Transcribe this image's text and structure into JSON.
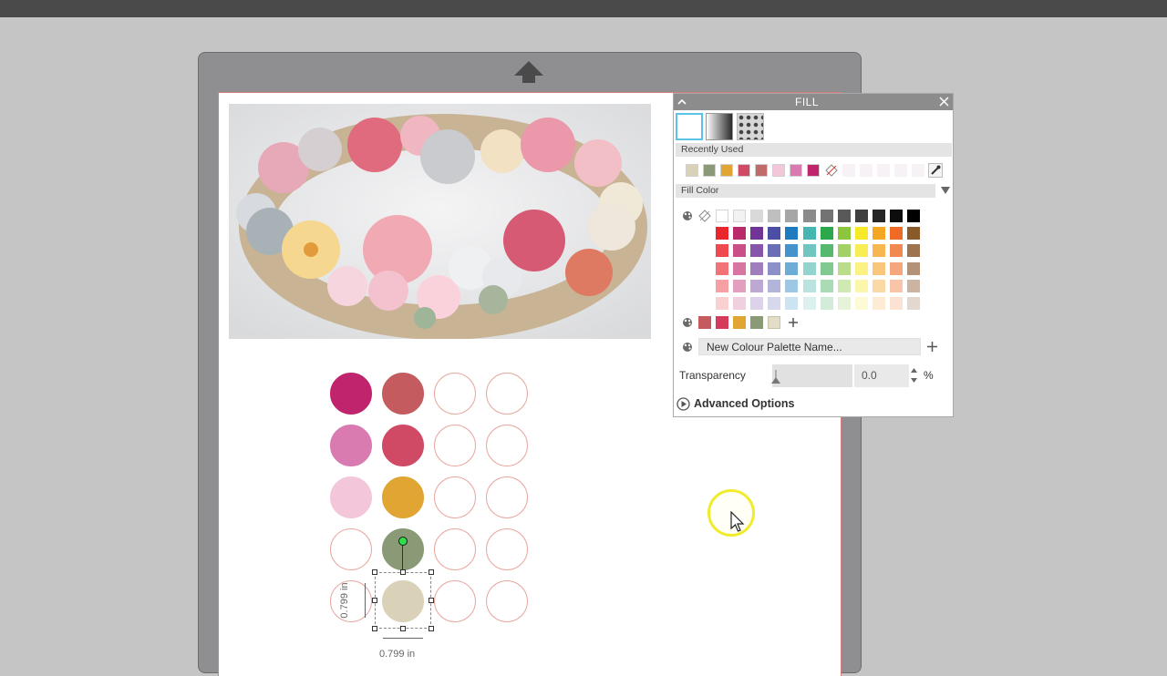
{
  "fill_panel": {
    "title": "FILL",
    "recently_used_label": "Recently Used",
    "fill_color_label": "Fill Color",
    "palette_name_placeholder": "New Colour Palette Name...",
    "transparency_label": "Transparency",
    "transparency_value": "0.0",
    "transparency_unit": "%",
    "advanced_label": "Advanced Options",
    "recently_used": [
      "#d9d1b8",
      "#8a9a76",
      "#e0a532",
      "#d04a66",
      "#c06a6a",
      "#f4c6d9",
      "#d97ab0",
      "#c0246c"
    ],
    "custom_palette": [
      "#c35b5f",
      "#d53b5b",
      "#e0a532",
      "#8a9a76",
      "#e3dcc6"
    ],
    "grid": [
      [
        "#ffffff",
        "#f2f2f2",
        "#d9d9d9",
        "#bfbfbf",
        "#a6a6a6",
        "#8c8c8c",
        "#737373",
        "#595959",
        "#404040",
        "#262626",
        "#0d0d0d",
        "#000000"
      ],
      [
        "#e8262b",
        "#b82a6b",
        "#6f3496",
        "#4a4ea5",
        "#1f7bbe",
        "#46b7b0",
        "#2aa84a",
        "#8cc63f",
        "#f7e928",
        "#f5a623",
        "#ef6b25",
        "#8b5a2b"
      ],
      [
        "#ee4a4f",
        "#c94f86",
        "#8756aa",
        "#6a6eb7",
        "#4493cc",
        "#6fc5bf",
        "#57b96d",
        "#a3d165",
        "#f9ed56",
        "#f7b64f",
        "#f28950",
        "#9e7450"
      ],
      [
        "#f27377",
        "#d676a1",
        "#a07ebe",
        "#8c8fc8",
        "#6eacd8",
        "#94d4cf",
        "#80ca91",
        "#badc8b",
        "#fbf283",
        "#f9c77b",
        "#f5a67c",
        "#b39277"
      ],
      [
        "#f6a0a3",
        "#e3a0be",
        "#bda7d3",
        "#b2b4da",
        "#9cc8e6",
        "#b9e3df",
        "#a9dbb5",
        "#d0e8b1",
        "#fcf6ad",
        "#fbd9a7",
        "#f9c5a8",
        "#cbb4a1"
      ],
      [
        "#fad0d1",
        "#f0cfde",
        "#dcd2e9",
        "#d7d8ec",
        "#cce3f2",
        "#dcf1ef",
        "#d3ecd9",
        "#e7f3d8",
        "#fdfad6",
        "#fdecd3",
        "#fce2d3",
        "#e3d8cf"
      ]
    ]
  },
  "canvas": {
    "circles": [
      [
        "#c0246c",
        "#c35b5f",
        "",
        ""
      ],
      [
        "#d97ab0",
        "#d04a66",
        "",
        ""
      ],
      [
        "#f4c6d9",
        "#e0a532",
        "",
        ""
      ],
      [
        "",
        "#8a9a76",
        "",
        ""
      ],
      [
        "",
        "#d9d1b8",
        "",
        ""
      ]
    ],
    "outline_color": "#e8a8a0",
    "height_label": "0.799 in",
    "width_label": "0.799 in"
  }
}
